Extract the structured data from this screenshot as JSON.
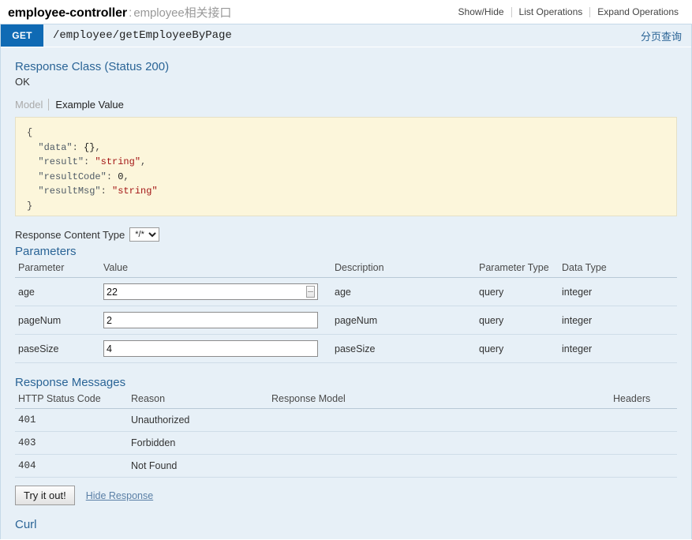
{
  "resource": {
    "name": "employee-controller",
    "separator": ":",
    "description": "employee相关接口",
    "options": [
      {
        "label": "Show/Hide"
      },
      {
        "label": "List Operations"
      },
      {
        "label": "Expand Operations"
      }
    ]
  },
  "operation": {
    "method": "GET",
    "path": "/employee/getEmployeeByPage",
    "summary": "分页查询"
  },
  "response_class": {
    "heading": "Response Class (Status 200)",
    "status_text": "OK",
    "tabs": [
      {
        "label": "Model",
        "active": false
      },
      {
        "label": "Example Value",
        "active": true
      }
    ],
    "example_value": {
      "open_brace": "{",
      "close_brace": "}",
      "lines": [
        {
          "key": "\"data\"",
          "value": "{}",
          "value_type": "object",
          "comma": ","
        },
        {
          "key": "\"result\"",
          "value": "\"string\"",
          "value_type": "string",
          "comma": ","
        },
        {
          "key": "\"resultCode\"",
          "value": "0",
          "value_type": "number",
          "comma": ","
        },
        {
          "key": "\"resultMsg\"",
          "value": "\"string\"",
          "value_type": "string",
          "comma": ""
        }
      ]
    }
  },
  "content_type": {
    "label": "Response Content Type",
    "selected": "*/*",
    "options": [
      "*/*"
    ]
  },
  "parameters": {
    "heading": "Parameters",
    "columns": [
      "Parameter",
      "Value",
      "Description",
      "Parameter Type",
      "Data Type"
    ],
    "rows": [
      {
        "name": "age",
        "value": "22",
        "description": "age",
        "param_type": "query",
        "data_type": "integer",
        "spinner": true
      },
      {
        "name": "pageNum",
        "value": "2",
        "description": "pageNum",
        "param_type": "query",
        "data_type": "integer",
        "spinner": false
      },
      {
        "name": "paseSize",
        "value": "4",
        "description": "paseSize",
        "param_type": "query",
        "data_type": "integer",
        "spinner": false
      }
    ]
  },
  "response_messages": {
    "heading": "Response Messages",
    "columns": [
      "HTTP Status Code",
      "Reason",
      "Response Model",
      "Headers"
    ],
    "rows": [
      {
        "code": "401",
        "reason": "Unauthorized",
        "model": "",
        "headers": ""
      },
      {
        "code": "403",
        "reason": "Forbidden",
        "model": "",
        "headers": ""
      },
      {
        "code": "404",
        "reason": "Not Found",
        "model": "",
        "headers": ""
      }
    ]
  },
  "actions": {
    "try_label": "Try it out!",
    "hide_response_label": "Hide Response"
  },
  "curl": {
    "heading": "Curl"
  },
  "colors": {
    "method_get": "#0f6ab4",
    "panel_background": "#e7f0f7",
    "link_blue": "#2a6496",
    "snippet_background": "#fcf6db"
  }
}
